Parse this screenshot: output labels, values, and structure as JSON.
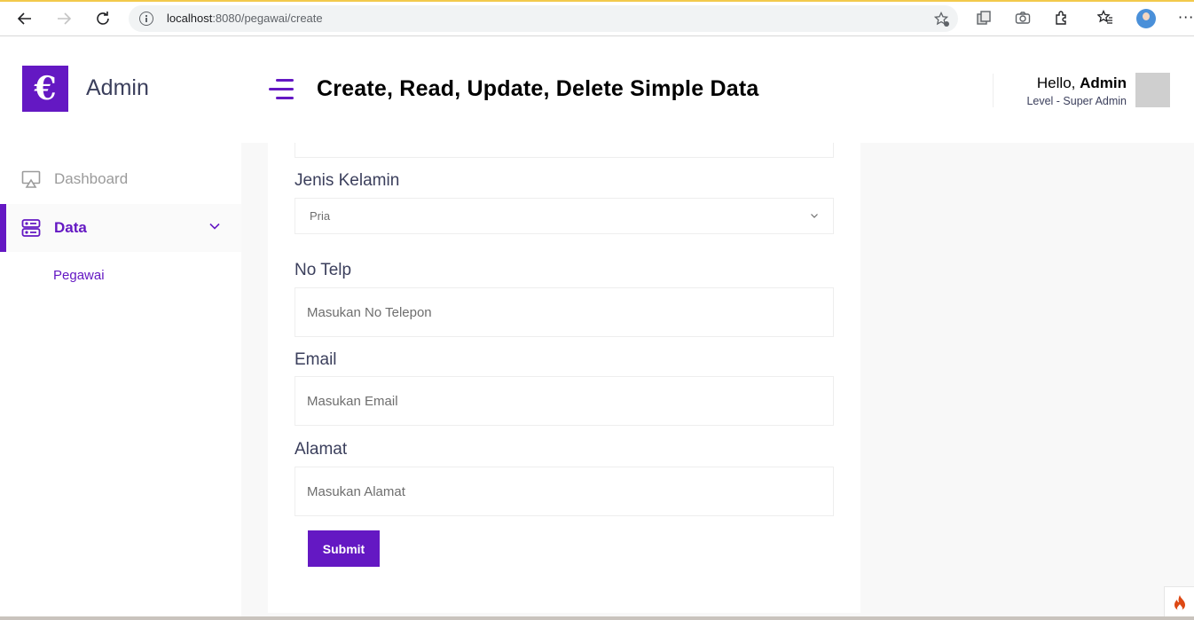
{
  "browser": {
    "url_host": "localhost",
    "url_path": ":8080/pegawai/create"
  },
  "sidebar": {
    "logo_glyph": "€",
    "brand": "Admin",
    "items": [
      {
        "label": "Dashboard",
        "icon": "monitor-icon",
        "active": false
      },
      {
        "label": "Data",
        "icon": "database-icon",
        "active": true
      }
    ],
    "submenu": [
      {
        "label": "Pegawai"
      }
    ]
  },
  "header": {
    "title": "Create, Read, Update, Delete Simple Data",
    "greeting": "Hello,",
    "user": "Admin",
    "level": "Level - Super Admin"
  },
  "form": {
    "gender_label": "Jenis Kelamin",
    "gender_value": "Pria",
    "phone_label": "No Telp",
    "phone_placeholder": "Masukan No Telepon",
    "email_label": "Email",
    "email_placeholder": "Masukan Email",
    "address_label": "Alamat",
    "address_placeholder": "Masukan Alamat",
    "submit_label": "Submit"
  },
  "colors": {
    "accent": "#6418c3",
    "text": "#3b3f5c"
  }
}
